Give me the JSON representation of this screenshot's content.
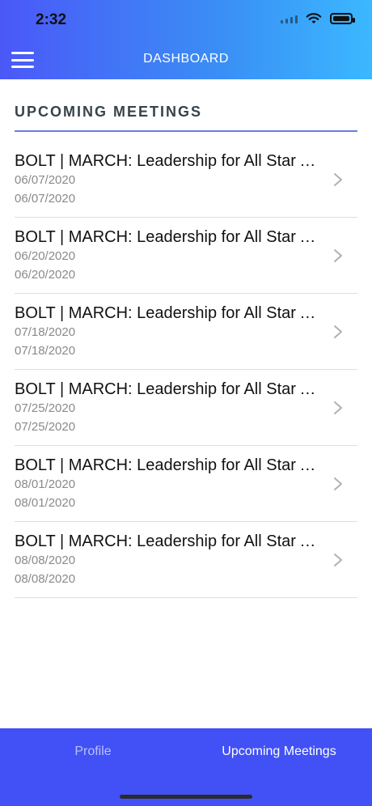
{
  "status_bar": {
    "time": "2:32"
  },
  "header": {
    "title": "DASHBOARD"
  },
  "section": {
    "title": "UPCOMING MEETINGS"
  },
  "meetings": [
    {
      "title": "BOLT | MARCH: Leadership for All Star At...",
      "date_start": "06/07/2020",
      "date_end": "06/07/2020"
    },
    {
      "title": "BOLT | MARCH: Leadership for All Star At...",
      "date_start": "06/20/2020",
      "date_end": "06/20/2020"
    },
    {
      "title": "BOLT | MARCH: Leadership for All Star At...",
      "date_start": "07/18/2020",
      "date_end": "07/18/2020"
    },
    {
      "title": "BOLT | MARCH: Leadership for All Star At...",
      "date_start": "07/25/2020",
      "date_end": "07/25/2020"
    },
    {
      "title": "BOLT | MARCH: Leadership for All Star At...",
      "date_start": "08/01/2020",
      "date_end": "08/01/2020"
    },
    {
      "title": "BOLT | MARCH: Leadership for All Star At...",
      "date_start": "08/08/2020",
      "date_end": "08/08/2020"
    }
  ],
  "tabs": [
    {
      "label": "Profile",
      "active": false
    },
    {
      "label": "Upcoming Meetings",
      "active": true
    }
  ],
  "colors": {
    "header_gradient_start": "#4b58f8",
    "header_gradient_end": "#3bb8ff",
    "tabbar": "#4151f5",
    "divider_accent": "#6b7be4"
  },
  "icons": {
    "menu": "hamburger-menu-icon",
    "chevron": "chevron-right-icon",
    "wifi": "wifi-icon",
    "battery": "battery-icon",
    "signal": "cellular-signal-icon"
  }
}
